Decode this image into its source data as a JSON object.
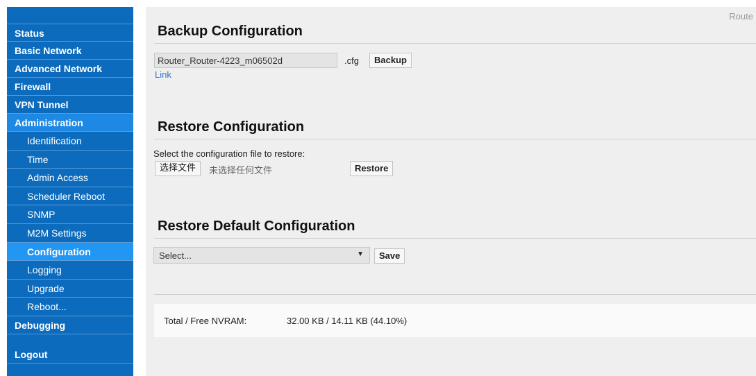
{
  "sidebar": {
    "items": [
      {
        "label": "Status"
      },
      {
        "label": "Basic Network"
      },
      {
        "label": "Advanced Network"
      },
      {
        "label": "Firewall"
      },
      {
        "label": "VPN Tunnel"
      },
      {
        "label": "Administration"
      },
      {
        "label": "Debugging"
      },
      {
        "label": "Logout"
      }
    ],
    "sub_items": [
      {
        "label": "Identification"
      },
      {
        "label": "Time"
      },
      {
        "label": "Admin Access"
      },
      {
        "label": "Scheduler Reboot"
      },
      {
        "label": "SNMP"
      },
      {
        "label": "M2M Settings"
      },
      {
        "label": "Configuration"
      },
      {
        "label": "Logging"
      },
      {
        "label": "Upgrade"
      },
      {
        "label": "Reboot..."
      }
    ]
  },
  "header": {
    "brand": "Route"
  },
  "backup": {
    "title": "Backup Configuration",
    "filename": "Router_Router-4223_m06502d",
    "extension": ".cfg",
    "button": "Backup",
    "link": "Link"
  },
  "restore": {
    "title": "Restore Configuration",
    "prompt": "Select the configuration file to restore:",
    "choose_button": "选择文件",
    "no_file_text": "未选择任何文件",
    "button": "Restore"
  },
  "restore_default": {
    "title": "Restore Default Configuration",
    "select_value": "Select...",
    "button": "Save"
  },
  "nvram": {
    "label": "Total / Free NVRAM:",
    "value": "32.00 KB / 14.11 KB (44.10%)"
  }
}
